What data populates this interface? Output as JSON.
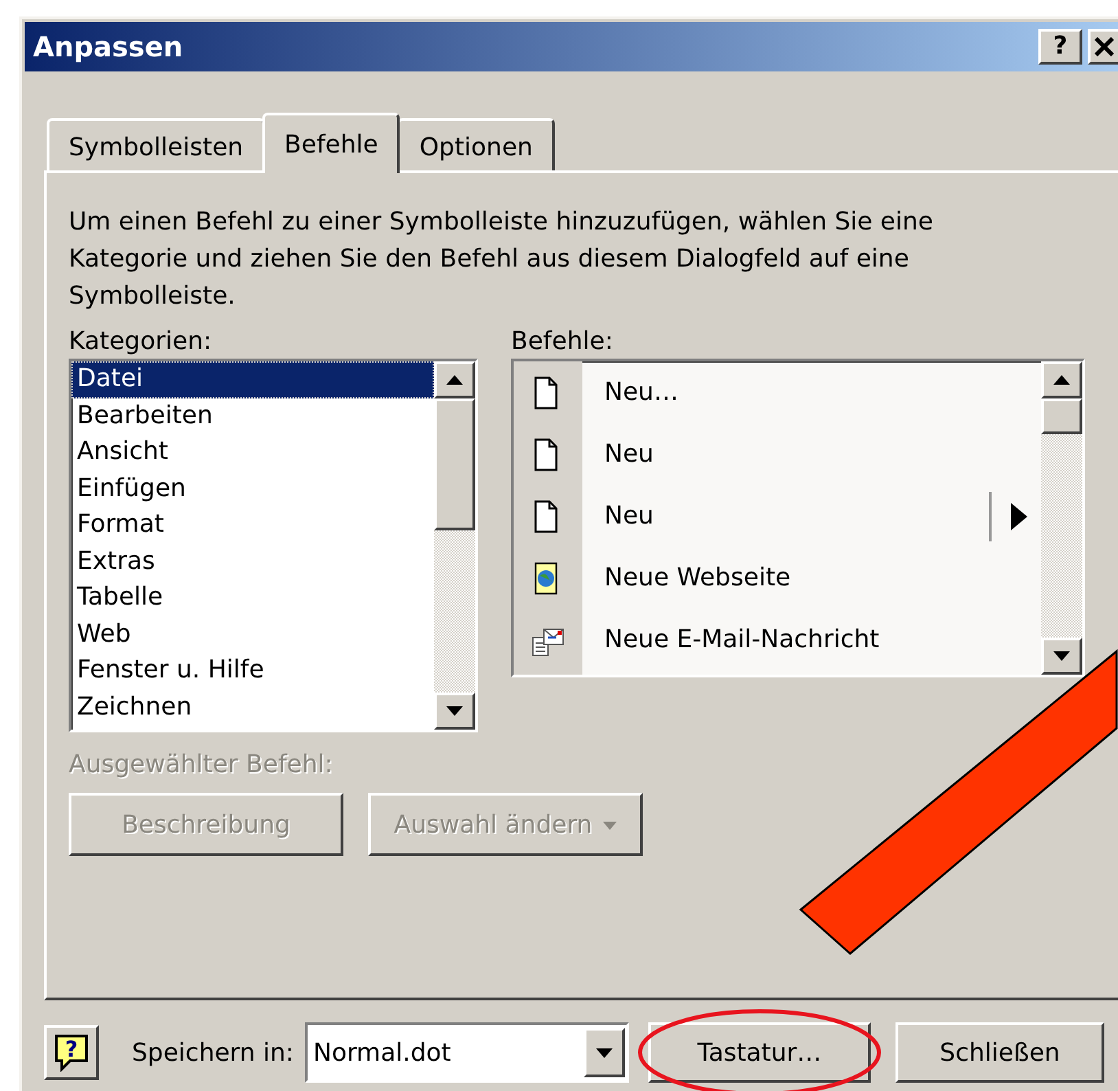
{
  "window": {
    "title": "Anpassen",
    "help_button": "?"
  },
  "tabs": [
    {
      "label": "Symbolleisten",
      "selected": false
    },
    {
      "label": "Befehle",
      "selected": true
    },
    {
      "label": "Optionen",
      "selected": false
    }
  ],
  "description": "Um einen Befehl zu einer Symbolleiste hinzuzufügen, wählen Sie eine Kategorie und ziehen Sie den Befehl aus diesem Dialogfeld auf eine Symbolleiste.",
  "categories": {
    "label": "Kategorien:",
    "items": [
      {
        "label": "Datei",
        "selected": true
      },
      {
        "label": "Bearbeiten",
        "selected": false
      },
      {
        "label": "Ansicht",
        "selected": false
      },
      {
        "label": "Einfügen",
        "selected": false
      },
      {
        "label": "Format",
        "selected": false
      },
      {
        "label": "Extras",
        "selected": false
      },
      {
        "label": "Tabelle",
        "selected": false
      },
      {
        "label": "Web",
        "selected": false
      },
      {
        "label": "Fenster u. Hilfe",
        "selected": false
      },
      {
        "label": "Zeichnen",
        "selected": false
      }
    ]
  },
  "commands": {
    "label": "Befehle:",
    "items": [
      {
        "label": "Neu…",
        "kind": "page",
        "submenu": false
      },
      {
        "label": "Neu",
        "kind": "page",
        "submenu": false
      },
      {
        "label": "Neu",
        "kind": "page",
        "submenu": true
      },
      {
        "label": "Neue Webseite",
        "kind": "webpage",
        "submenu": false
      },
      {
        "label": "Neue E-Mail-Nachricht",
        "kind": "mail",
        "submenu": false
      }
    ]
  },
  "selected_command": {
    "label": "Ausgewählter Befehl:",
    "disabled": true
  },
  "buttons": [
    {
      "label": "Beschreibung",
      "disabled": true,
      "dropdown": false
    },
    {
      "label": "Auswahl ändern",
      "disabled": true,
      "dropdown": true
    }
  ],
  "footer": {
    "help_glyph": "?",
    "save_label": "Speichern in:",
    "save_value": "Normal.dot",
    "buttons": [
      {
        "label": "Tastatur…",
        "highlighted": true
      },
      {
        "label": "Schließen",
        "highlighted": false
      }
    ]
  }
}
